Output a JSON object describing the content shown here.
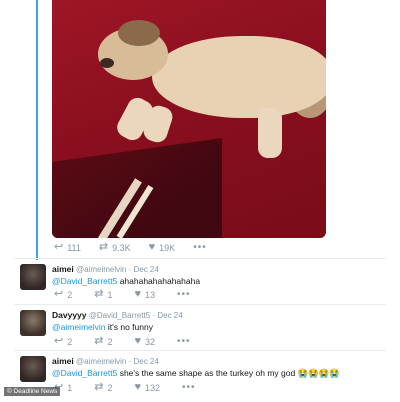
{
  "main_tweet": {
    "stats": {
      "replies": "111",
      "retweets": "9.3K",
      "likes": "19K"
    },
    "more": "•••"
  },
  "replies": [
    {
      "name": "aimei",
      "handle": "@aimeimelvin",
      "date": "· Dec 24",
      "mention": "@David_Barrett5",
      "text": " ahahahahahahahaha",
      "stats": {
        "replies": "2",
        "retweets": "1",
        "likes": "13"
      }
    },
    {
      "name": "Davyyyy",
      "handle": "@David_Barrett5",
      "date": "· Dec 24",
      "mention": "@aimeimelvin",
      "text": " it's no funny",
      "stats": {
        "replies": "2",
        "retweets": "2",
        "likes": "32"
      }
    },
    {
      "name": "aimei",
      "handle": "@aimeimelvin",
      "date": "· Dec 24",
      "mention": "@David_Barrett5",
      "text": " she's the same shape as the turkey oh my god 😭😭😭😭",
      "stats": {
        "replies": "1",
        "retweets": "2",
        "likes": "132"
      }
    }
  ],
  "watermark": "© Deadline News",
  "icons": {
    "reply": "↩",
    "retweet": "⇄",
    "like": "♥",
    "more": "•••"
  },
  "colors": {
    "thread_line": "#3aa8d8",
    "mention": "#1b95e0",
    "muted": "#8899a6",
    "carpet": "#9e1626"
  }
}
